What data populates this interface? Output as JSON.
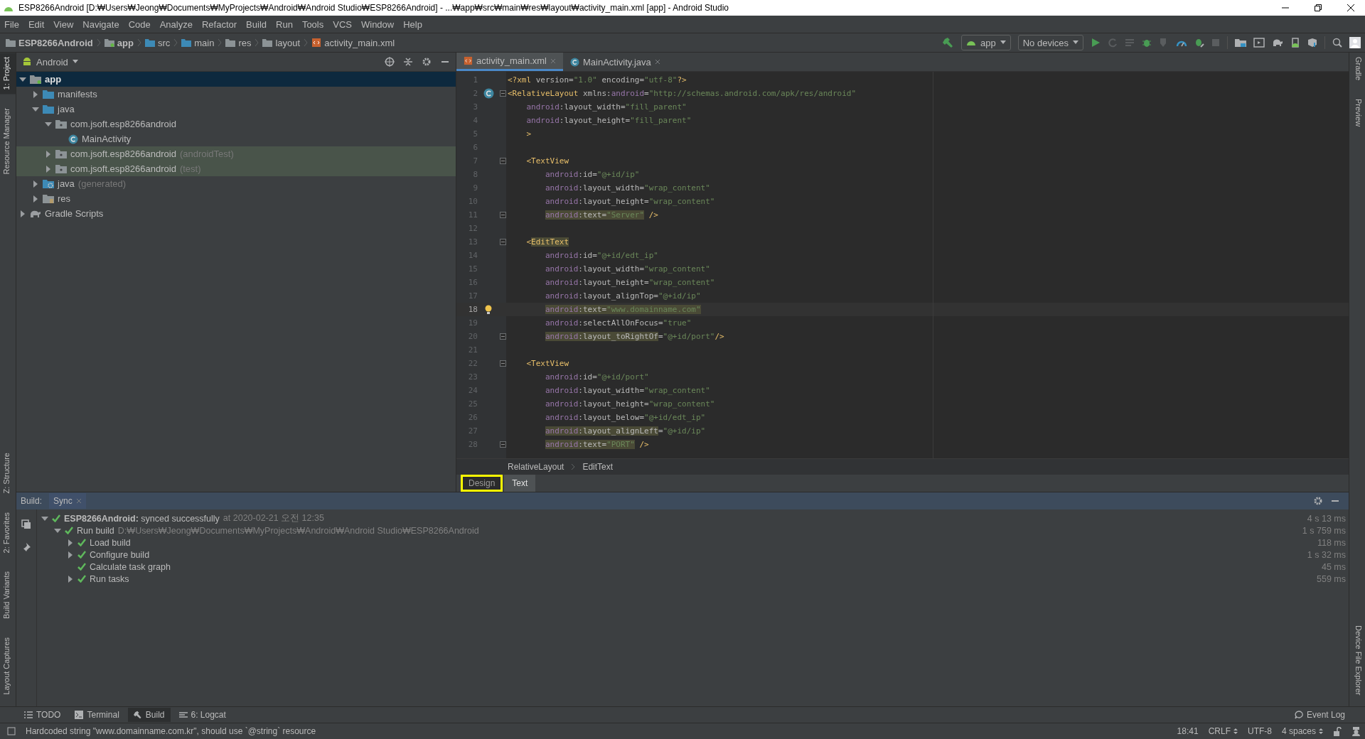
{
  "window": {
    "title": "ESP8266Android [D:₩Users₩Jeong₩Documents₩MyProjects₩Android₩Android Studio₩ESP8266Android] - ...₩app₩src₩main₩res₩layout₩activity_main.xml [app] - Android Studio"
  },
  "menu": [
    "File",
    "Edit",
    "View",
    "Navigate",
    "Code",
    "Analyze",
    "Refactor",
    "Build",
    "Run",
    "Tools",
    "VCS",
    "Window",
    "Help"
  ],
  "breadcrumb": [
    {
      "label": "ESP8266Android",
      "kind": "project"
    },
    {
      "label": "app",
      "kind": "module"
    },
    {
      "label": "src",
      "kind": "folder"
    },
    {
      "label": "main",
      "kind": "folder"
    },
    {
      "label": "res",
      "kind": "res"
    },
    {
      "label": "layout",
      "kind": "layout"
    },
    {
      "label": "activity_main.xml",
      "kind": "xml"
    }
  ],
  "toolbar": {
    "run_config": "app",
    "device": "No devices"
  },
  "left_tool_strip": {
    "top": [
      {
        "label": "1: Project",
        "selected": true
      },
      {
        "label": "Resource Manager",
        "selected": false
      }
    ],
    "bottom": [
      {
        "label": "Z: Structure",
        "selected": false
      },
      {
        "label": "2: Favorites",
        "selected": false
      },
      {
        "label": "Build Variants",
        "selected": false
      },
      {
        "label": "Layout Captures",
        "selected": false
      }
    ]
  },
  "right_tool_strip": {
    "top": [
      {
        "label": "Gradle",
        "selected": false
      },
      {
        "label": "Preview",
        "selected": false
      }
    ],
    "bottom": [
      {
        "label": "Device File Explorer",
        "selected": false
      }
    ]
  },
  "project": {
    "view": "Android",
    "tree": [
      {
        "label": "app",
        "kind": "module",
        "selected": true,
        "highlighted": false,
        "expanded": true,
        "children": [
          {
            "label": "manifests",
            "kind": "folder",
            "selected": false,
            "highlighted": false,
            "expanded": false
          },
          {
            "label": "java",
            "kind": "folder",
            "selected": false,
            "highlighted": false,
            "expanded": true,
            "children": [
              {
                "label": "com.jsoft.esp8266android",
                "kind": "package",
                "selected": false,
                "highlighted": false,
                "expanded": true,
                "children": [
                  {
                    "label": "MainActivity",
                    "kind": "class",
                    "selected": false,
                    "highlighted": false
                  }
                ]
              },
              {
                "label": "com.jsoft.esp8266android",
                "suffix": "(androidTest)",
                "kind": "package",
                "selected": false,
                "highlighted": true,
                "expanded": false
              },
              {
                "label": "com.jsoft.esp8266android",
                "suffix": "(test)",
                "kind": "package",
                "selected": false,
                "highlighted": true,
                "expanded": false
              }
            ]
          },
          {
            "label": "java",
            "suffix": "(generated)",
            "kind": "generated",
            "selected": false,
            "highlighted": false,
            "expanded": false
          },
          {
            "label": "res",
            "kind": "res",
            "selected": false,
            "highlighted": false,
            "expanded": false
          }
        ]
      },
      {
        "label": "Gradle Scripts",
        "kind": "gradle",
        "selected": false,
        "highlighted": false,
        "expanded": false
      }
    ]
  },
  "editor": {
    "tabs": [
      {
        "label": "activity_main.xml",
        "kind": "xml",
        "selected": true
      },
      {
        "label": "MainActivity.java",
        "kind": "class",
        "selected": false
      }
    ],
    "lines": [
      {
        "no": "1",
        "kind": "root",
        "fold": false,
        "current": false,
        "segments": [
          {
            "kind": "tag",
            "text": "<?xml"
          },
          {
            "kind": "attr",
            "text": " version="
          },
          {
            "kind": "val",
            "text": "\"1.0\""
          },
          {
            "kind": "attr",
            "text": " encoding="
          },
          {
            "kind": "val",
            "text": "\"utf-8\""
          },
          {
            "kind": "tag",
            "text": "?>"
          }
        ]
      },
      {
        "no": "2",
        "kind": "root",
        "fold": true,
        "current": false,
        "gutter": {
          "kind": "class"
        },
        "segments": [
          {
            "kind": "tag",
            "text": "<RelativeLayout"
          },
          {
            "kind": "attr",
            "text": " xmlns:"
          },
          {
            "kind": "ns",
            "text": "android"
          },
          {
            "kind": "attr",
            "text": "="
          },
          {
            "kind": "val",
            "text": "\"http://schemas.android.com/apk/res/android\""
          }
        ]
      },
      {
        "no": "3",
        "kind": "nested",
        "fold": false,
        "current": false,
        "segments": [
          {
            "kind": "ns",
            "text": "android"
          },
          {
            "kind": "attr",
            "text": ":layout_width="
          },
          {
            "kind": "val",
            "text": "\"fill_parent\""
          }
        ]
      },
      {
        "no": "4",
        "kind": "nested",
        "fold": false,
        "current": false,
        "segments": [
          {
            "kind": "ns",
            "text": "android"
          },
          {
            "kind": "attr",
            "text": ":layout_height="
          },
          {
            "kind": "val",
            "text": "\"fill_parent\""
          }
        ]
      },
      {
        "no": "5",
        "kind": "nested",
        "fold": false,
        "current": false,
        "segments": [
          {
            "kind": "tag",
            "text": ">"
          }
        ]
      },
      {
        "no": "6",
        "fold": false,
        "current": false
      },
      {
        "no": "7",
        "kind": "nested",
        "fold": true,
        "current": false,
        "segments": [
          {
            "kind": "tag",
            "text": "<TextView"
          }
        ]
      },
      {
        "no": "8",
        "kind": "deep",
        "fold": false,
        "current": false,
        "segments": [
          {
            "kind": "ns",
            "text": "android"
          },
          {
            "kind": "attr",
            "text": ":id="
          },
          {
            "kind": "val",
            "text": "\"@+id/ip\""
          }
        ]
      },
      {
        "no": "9",
        "kind": "deep",
        "fold": false,
        "current": false,
        "segments": [
          {
            "kind": "ns",
            "text": "android"
          },
          {
            "kind": "attr",
            "text": ":layout_width="
          },
          {
            "kind": "val",
            "text": "\"wrap_content\""
          }
        ]
      },
      {
        "no": "10",
        "kind": "deep",
        "fold": false,
        "current": false,
        "segments": [
          {
            "kind": "ns",
            "text": "android"
          },
          {
            "kind": "attr",
            "text": ":layout_height="
          },
          {
            "kind": "val",
            "text": "\"wrap_content\""
          }
        ]
      },
      {
        "no": "11",
        "kind": "deep",
        "fold": true,
        "current": false,
        "segments": [
          {
            "kind": "ns",
            "text": "android",
            "highlighted": true
          },
          {
            "kind": "attr",
            "text": ":text=",
            "highlighted": true
          },
          {
            "kind": "val",
            "text": "\"Server\"",
            "highlighted": true
          },
          {
            "kind": "tag",
            "text": " />",
            "highlighted": false
          }
        ]
      },
      {
        "no": "12",
        "fold": false,
        "current": false
      },
      {
        "no": "13",
        "kind": "nested",
        "fold": true,
        "current": false,
        "segments": [
          {
            "kind": "tag",
            "text": "<",
            "highlighted": false
          },
          {
            "kind": "tag",
            "text": "EditText",
            "highlighted": true
          }
        ]
      },
      {
        "no": "14",
        "kind": "deep",
        "fold": false,
        "current": false,
        "segments": [
          {
            "kind": "ns",
            "text": "android"
          },
          {
            "kind": "attr",
            "text": ":id="
          },
          {
            "kind": "val",
            "text": "\"@+id/edt_ip\""
          }
        ]
      },
      {
        "no": "15",
        "kind": "deep",
        "fold": false,
        "current": false,
        "segments": [
          {
            "kind": "ns",
            "text": "android"
          },
          {
            "kind": "attr",
            "text": ":layout_width="
          },
          {
            "kind": "val",
            "text": "\"wrap_content\""
          }
        ]
      },
      {
        "no": "16",
        "kind": "deep",
        "fold": false,
        "current": false,
        "segments": [
          {
            "kind": "ns",
            "text": "android"
          },
          {
            "kind": "attr",
            "text": ":layout_height="
          },
          {
            "kind": "val",
            "text": "\"wrap_content\""
          }
        ]
      },
      {
        "no": "17",
        "kind": "deep",
        "fold": false,
        "current": false,
        "segments": [
          {
            "kind": "ns",
            "text": "android"
          },
          {
            "kind": "attr",
            "text": ":layout_alignTop="
          },
          {
            "kind": "val",
            "text": "\"@+id/ip\""
          }
        ]
      },
      {
        "no": "18",
        "kind": "deep",
        "fold": false,
        "current": true,
        "gutter": {
          "kind": "bulb"
        },
        "segments": [
          {
            "kind": "ns",
            "text": "android",
            "highlighted": true
          },
          {
            "kind": "attr",
            "text": ":text=",
            "highlighted": true
          },
          {
            "kind": "val",
            "text": "\"www.domainname.com\"",
            "highlighted": true
          }
        ]
      },
      {
        "no": "19",
        "kind": "deep",
        "fold": false,
        "current": false,
        "segments": [
          {
            "kind": "ns",
            "text": "android"
          },
          {
            "kind": "attr",
            "text": ":selectAllOnFocus="
          },
          {
            "kind": "val",
            "text": "\"true\""
          }
        ]
      },
      {
        "no": "20",
        "kind": "deep",
        "fold": true,
        "current": false,
        "segments": [
          {
            "kind": "ns",
            "text": "android",
            "highlighted": true
          },
          {
            "kind": "attr",
            "text": ":layout_toRightOf",
            "highlighted": true
          },
          {
            "kind": "attr",
            "text": "=",
            "highlighted": false
          },
          {
            "kind": "val",
            "text": "\"@+id/port\"",
            "highlighted": false
          },
          {
            "kind": "tag",
            "text": "/>",
            "highlighted": false
          }
        ]
      },
      {
        "no": "21",
        "fold": false,
        "current": false
      },
      {
        "no": "22",
        "kind": "nested",
        "fold": true,
        "current": false,
        "segments": [
          {
            "kind": "tag",
            "text": "<TextView"
          }
        ]
      },
      {
        "no": "23",
        "kind": "deep",
        "fold": false,
        "current": false,
        "segments": [
          {
            "kind": "ns",
            "text": "android"
          },
          {
            "kind": "attr",
            "text": ":id="
          },
          {
            "kind": "val",
            "text": "\"@+id/port\""
          }
        ]
      },
      {
        "no": "24",
        "kind": "deep",
        "fold": false,
        "current": false,
        "segments": [
          {
            "kind": "ns",
            "text": "android"
          },
          {
            "kind": "attr",
            "text": ":layout_width="
          },
          {
            "kind": "val",
            "text": "\"wrap_content\""
          }
        ]
      },
      {
        "no": "25",
        "kind": "deep",
        "fold": false,
        "current": false,
        "segments": [
          {
            "kind": "ns",
            "text": "android"
          },
          {
            "kind": "attr",
            "text": ":layout_height="
          },
          {
            "kind": "val",
            "text": "\"wrap_content\""
          }
        ]
      },
      {
        "no": "26",
        "kind": "deep",
        "fold": false,
        "current": false,
        "segments": [
          {
            "kind": "ns",
            "text": "android"
          },
          {
            "kind": "attr",
            "text": ":layout_below="
          },
          {
            "kind": "val",
            "text": "\"@+id/edt_ip\""
          }
        ]
      },
      {
        "no": "27",
        "kind": "deep",
        "fold": false,
        "current": false,
        "segments": [
          {
            "kind": "ns",
            "text": "android",
            "highlighted": true
          },
          {
            "kind": "attr",
            "text": ":layout_alignLeft",
            "highlighted": true
          },
          {
            "kind": "attr",
            "text": "=",
            "highlighted": false
          },
          {
            "kind": "val",
            "text": "\"@+id/ip\"",
            "highlighted": false
          }
        ]
      },
      {
        "no": "28",
        "kind": "deep",
        "fold": true,
        "current": false,
        "segments": [
          {
            "kind": "ns",
            "text": "android",
            "highlighted": true
          },
          {
            "kind": "attr",
            "text": ":text=",
            "highlighted": true
          },
          {
            "kind": "val",
            "text": "\"PORT\"",
            "highlighted": true
          },
          {
            "kind": "tag",
            "text": " />",
            "highlighted": false
          }
        ]
      }
    ],
    "path": [
      "RelativeLayout",
      "EditText"
    ],
    "mode_tabs": [
      {
        "label": "Design",
        "selected": false,
        "highlighted": true
      },
      {
        "label": "Text",
        "selected": true,
        "highlighted": false
      }
    ]
  },
  "build": {
    "title": "Build:",
    "tabs": [
      {
        "label": "Sync",
        "selected": true
      }
    ],
    "tree": [
      {
        "label": "**ESP8266Android:** synced successfully",
        "detail": "at 2020-02-21 오전 12:35",
        "time": "4 s 13 ms",
        "expanded": true,
        "children": [
          {
            "label": "Run build",
            "detail": "D:₩Users₩Jeong₩Documents₩MyProjects₩Android₩Android Studio₩ESP8266Android",
            "time": "1 s 759 ms",
            "expanded": true,
            "children": [
              {
                "label": "Load build",
                "time": "118 ms",
                "expanded": false
              },
              {
                "label": "Configure build",
                "time": "1 s 32 ms",
                "expanded": false
              },
              {
                "label": "Calculate task graph",
                "time": "45 ms"
              },
              {
                "label": "Run tasks",
                "time": "559 ms",
                "expanded": false
              }
            ]
          }
        ]
      }
    ]
  },
  "tool_tabs": [
    {
      "label": "TODO",
      "kind": "todo",
      "selected": false
    },
    {
      "label": "Terminal",
      "kind": "terminal",
      "selected": false
    },
    {
      "label": "Build",
      "kind": "build",
      "selected": true
    },
    {
      "label": "6: Logcat",
      "kind": "logcat",
      "selected": false
    }
  ],
  "event_log": "Event Log",
  "status_bar": {
    "message": "Hardcoded string \"www.domainname.com.kr\", should use `@string` resource",
    "position": "18:41",
    "line_separator": "CRLF",
    "encoding": "UTF-8",
    "indent": "4 spaces"
  }
}
